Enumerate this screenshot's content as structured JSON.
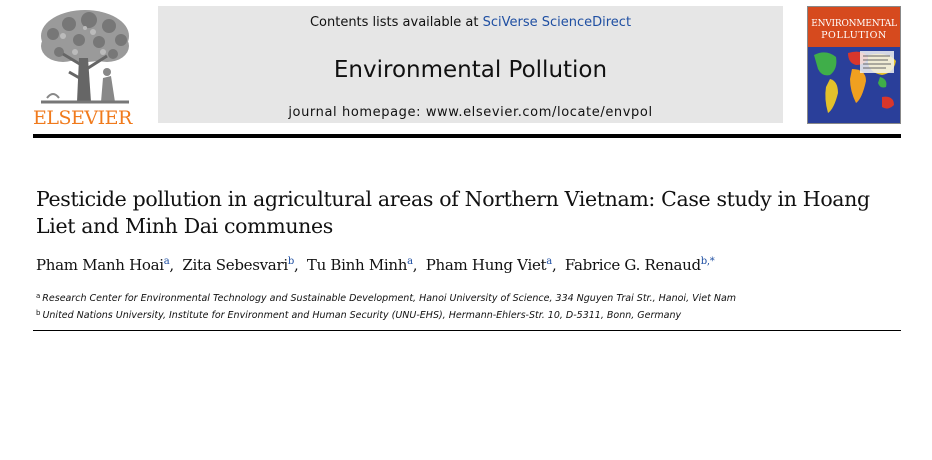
{
  "header": {
    "publisher": "ELSEVIER",
    "contents_prefix": "Contents lists available at ",
    "contents_link": "SciVerse ScienceDirect",
    "journal_title": "Environmental Pollution",
    "homepage_prefix": "journal homepage: ",
    "homepage_url": "www.elsevier.com/locate/envpol",
    "cover_title_line1": "ENVIRONMENTAL",
    "cover_title_line2": "POLLUTION"
  },
  "article": {
    "title": "Pesticide pollution in agricultural areas of Northern Vietnam: Case study in Hoang Liet and Minh Dai communes",
    "authors": [
      {
        "name": "Pham Manh Hoai",
        "sup": "a"
      },
      {
        "name": "Zita Sebesvari",
        "sup": "b"
      },
      {
        "name": "Tu Binh Minh",
        "sup": "a"
      },
      {
        "name": "Pham Hung Viet",
        "sup": "a"
      },
      {
        "name": "Fabrice G. Renaud",
        "sup": "b,*"
      }
    ],
    "affiliations": [
      {
        "mark": "a",
        "text": "Research Center for Environmental Technology and Sustainable Development, Hanoi University of Science, 334 Nguyen Trai Str., Hanoi, Viet Nam"
      },
      {
        "mark": "b",
        "text": "United Nations University, Institute for Environment and Human Security (UNU-EHS), Hermann-Ehlers-Str. 10, D-5311, Bonn, Germany"
      }
    ]
  },
  "colors": {
    "publisher_orange": "#f07a1c",
    "link_blue": "#1f4fa2",
    "journal_box_gray": "#e6e6e6",
    "cover_red": "#d64a1e"
  }
}
